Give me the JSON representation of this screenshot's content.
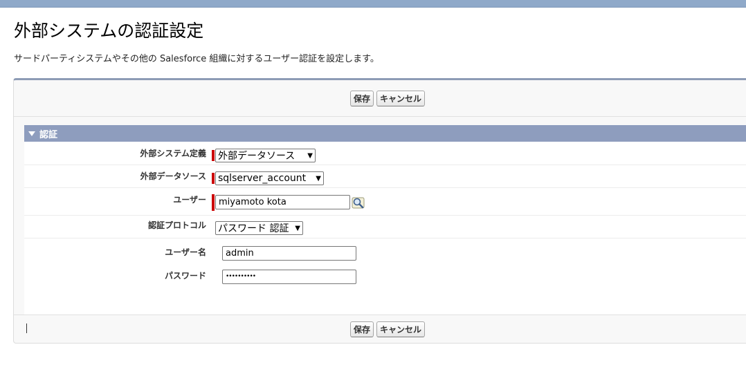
{
  "page": {
    "title": "外部システムの認証設定",
    "description": "サードパーティシステムやその他の Salesforce 組織に対するユーザー認証を設定します。"
  },
  "buttons": {
    "save": "保存",
    "cancel": "キャンセル"
  },
  "section": {
    "title": "認証"
  },
  "form": {
    "external_system": {
      "label": "外部システム定義",
      "value": "外部データソース",
      "required": true
    },
    "data_source": {
      "label": "外部データソース",
      "value": "sqlserver_account",
      "required": true
    },
    "user": {
      "label": "ユーザー",
      "value": "miyamoto kota",
      "required": true
    },
    "protocol": {
      "label": "認証プロトコル",
      "value": "パスワード 認証"
    },
    "username": {
      "label": "ユーザー名",
      "value": "admin"
    },
    "password": {
      "label": "パスワード",
      "value": "••••••••••"
    }
  },
  "colors": {
    "section_header": "#8e9dbe",
    "required_marker": "#cc0000",
    "top_band": "#8fa9c9"
  }
}
